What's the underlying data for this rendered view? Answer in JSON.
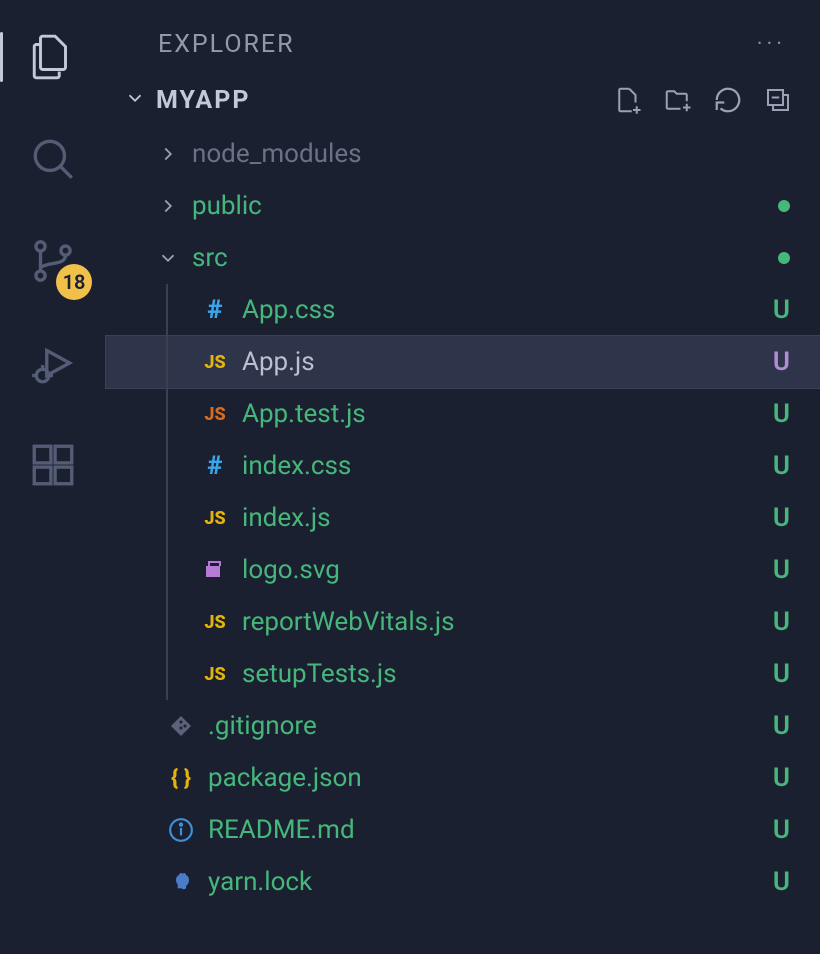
{
  "explorer": {
    "title": "EXPLORER",
    "section": "MYAPP"
  },
  "scm": {
    "badge": "18"
  },
  "icons": {
    "css": "#",
    "js": "JS",
    "json": "{ }",
    "svg": "■",
    "md": "ⓘ",
    "git": "◈",
    "yarn": "▲"
  },
  "status": {
    "u": "U"
  },
  "tree": [
    {
      "type": "folder",
      "name": "node_modules",
      "indent": 0,
      "expanded": false,
      "nameColor": "grey",
      "status": ""
    },
    {
      "type": "folder",
      "name": "public",
      "indent": 0,
      "expanded": false,
      "nameColor": "green",
      "status": "dot"
    },
    {
      "type": "folder",
      "name": "src",
      "indent": 0,
      "expanded": true,
      "nameColor": "green",
      "status": "dot"
    },
    {
      "type": "file",
      "name": "App.css",
      "indent": 2,
      "icon": "css",
      "nameColor": "green",
      "status": "u"
    },
    {
      "type": "file",
      "name": "App.js",
      "indent": 2,
      "icon": "js",
      "nameColor": "default",
      "status": "u-sel",
      "selected": true
    },
    {
      "type": "file",
      "name": "App.test.js",
      "indent": 2,
      "icon": "js-o",
      "nameColor": "green",
      "status": "u"
    },
    {
      "type": "file",
      "name": "index.css",
      "indent": 2,
      "icon": "css",
      "nameColor": "green",
      "status": "u"
    },
    {
      "type": "file",
      "name": "index.js",
      "indent": 2,
      "icon": "js",
      "nameColor": "green",
      "status": "u"
    },
    {
      "type": "file",
      "name": "logo.svg",
      "indent": 2,
      "icon": "svg",
      "nameColor": "green",
      "status": "u"
    },
    {
      "type": "file",
      "name": "reportWebVitals.js",
      "indent": 2,
      "icon": "js",
      "nameColor": "green",
      "status": "u"
    },
    {
      "type": "file",
      "name": "setupTests.js",
      "indent": 2,
      "icon": "js",
      "nameColor": "green",
      "status": "u"
    },
    {
      "type": "file",
      "name": ".gitignore",
      "indent": 1,
      "icon": "git",
      "nameColor": "green",
      "status": "u"
    },
    {
      "type": "file",
      "name": "package.json",
      "indent": 1,
      "icon": "json",
      "nameColor": "green",
      "status": "u"
    },
    {
      "type": "file",
      "name": "README.md",
      "indent": 1,
      "icon": "md",
      "nameColor": "green",
      "status": "u"
    },
    {
      "type": "file",
      "name": "yarn.lock",
      "indent": 1,
      "icon": "yarn",
      "nameColor": "green",
      "status": "u"
    }
  ]
}
